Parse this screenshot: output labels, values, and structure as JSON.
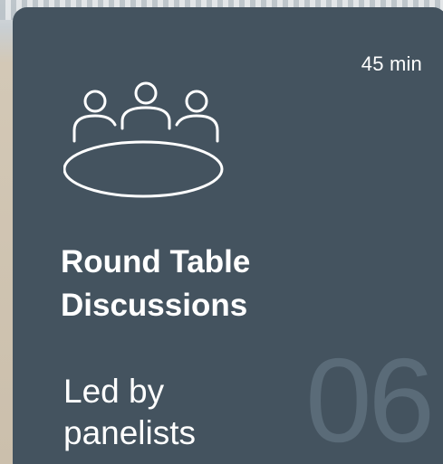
{
  "card": {
    "duration": "45 min",
    "title_line1": "Round Table",
    "title_line2": "Discussions",
    "subtitle_line1": "Led by",
    "subtitle_line2": "panelists",
    "number": "06",
    "icon": "round-table-meeting-icon"
  },
  "colors": {
    "card_background": "#44535f",
    "text": "#ffffff",
    "number": "#5a6b78"
  }
}
